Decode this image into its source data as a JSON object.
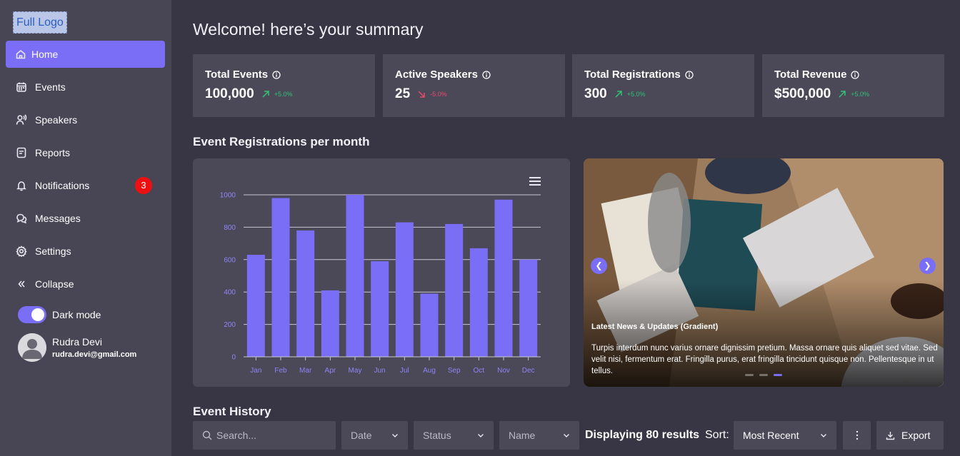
{
  "sidebar": {
    "logo": "Full Logo",
    "items": [
      {
        "label": "Home",
        "icon": "home-icon"
      },
      {
        "label": "Events",
        "icon": "calendar-icon"
      },
      {
        "label": "Speakers",
        "icon": "speaker-icon"
      },
      {
        "label": "Reports",
        "icon": "report-icon"
      },
      {
        "label": "Notifications",
        "icon": "bell-icon",
        "badge": "3"
      },
      {
        "label": "Messages",
        "icon": "messages-icon"
      },
      {
        "label": "Settings",
        "icon": "gear-icon"
      },
      {
        "label": "Collapse",
        "icon": "collapse-icon"
      }
    ],
    "dark_mode_label": "Dark mode",
    "user": {
      "name": "Rudra Devi",
      "email": "rudra.devi@gmail.com"
    }
  },
  "main": {
    "title": "Welcome! here’s your summary",
    "kpis": [
      {
        "label": "Total Events",
        "value": "100,000",
        "delta": "+5.0%",
        "trend": "up"
      },
      {
        "label": "Active Speakers",
        "value": "25",
        "delta": "-5.0%",
        "trend": "down"
      },
      {
        "label": "Total Registrations",
        "value": "300",
        "delta": "+5.0%",
        "trend": "up"
      },
      {
        "label": "Total Revenue",
        "value": "$500,000",
        "delta": "+5.0%",
        "trend": "up"
      }
    ],
    "chart_section_title": "Event Registrations per month",
    "news": {
      "title": "Latest News & Updates (Gradient)",
      "text": "Turpis interdum nunc varius ornare dignissim pretium. Massa ornare quis aliquet sed vitae. Sed velit nisi, fermentum erat. Fringilla purus, erat fringilla tincidunt quisque non. Pellentesque in ut tellus."
    },
    "history_title": "Event History",
    "filters": {
      "search_placeholder": "Search...",
      "date": "Date",
      "status": "Status",
      "name": "Name",
      "results": "Displaying 80 results",
      "sort_label": "Sort:",
      "sort_value": "Most Recent",
      "export": "Export"
    }
  },
  "colors": {
    "accent": "#7b6ef6",
    "up": "#2fc474",
    "down": "#e84a6b",
    "badge": "#ee1010"
  },
  "chart_data": {
    "type": "bar",
    "categories": [
      "Jan",
      "Feb",
      "Mar",
      "Apr",
      "May",
      "Jun",
      "Jul",
      "Aug",
      "Sep",
      "Oct",
      "Nov",
      "Dec"
    ],
    "values": [
      630,
      980,
      780,
      410,
      1000,
      590,
      830,
      390,
      820,
      670,
      970,
      600
    ],
    "yticks": [
      "0",
      "200",
      "400",
      "600",
      "800",
      "1000"
    ],
    "ylim": [
      0,
      1000
    ],
    "grid": true,
    "color": "#7b6ef6"
  }
}
